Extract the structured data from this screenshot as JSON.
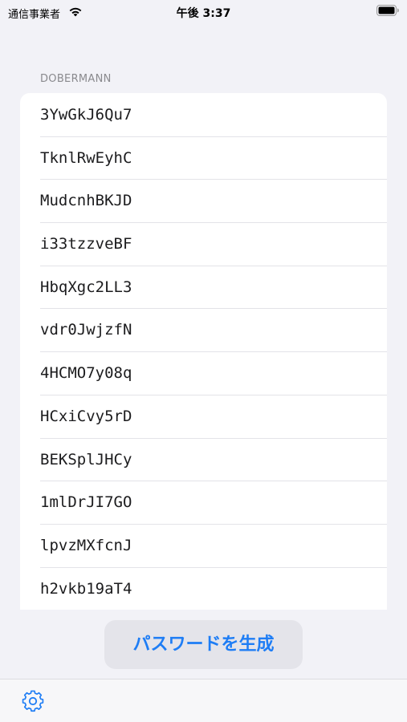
{
  "status_bar": {
    "carrier": "通信事業者",
    "time": "午後 3:37"
  },
  "section": {
    "header": "DOBERMANN"
  },
  "passwords": [
    "3YwGkJ6Qu7",
    "TknlRwEyhC",
    "MudcnhBKJD",
    "i33tzzveBF",
    "HbqXgc2LL3",
    "vdr0JwjzfN",
    "4HCMO7y08q",
    "HCxiCvy5rD",
    "BEKSplJHCy",
    "1mlDrJI7GO",
    "lpvzMXfcnJ",
    "h2vkb19aT4"
  ],
  "actions": {
    "generate_label": "パスワードを生成"
  },
  "icons": {
    "wifi": "wifi-icon",
    "battery": "battery-icon",
    "settings": "gear-icon"
  },
  "colors": {
    "background": "#f2f2f7",
    "accent": "#1e7df5",
    "card": "#ffffff",
    "section_header": "#8a8a8e"
  }
}
